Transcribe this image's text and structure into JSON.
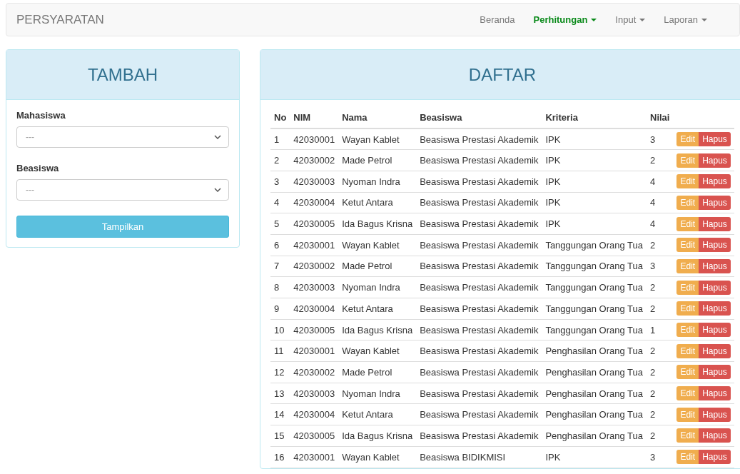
{
  "navbar": {
    "brand": "PERSYARATAN",
    "items": [
      {
        "label": "Beranda",
        "selected": false,
        "dropdown": false
      },
      {
        "label": "Perhitungan",
        "selected": true,
        "dropdown": true
      },
      {
        "label": "Input",
        "selected": false,
        "dropdown": true
      },
      {
        "label": "Laporan",
        "selected": false,
        "dropdown": true
      }
    ]
  },
  "add_panel": {
    "title": "TAMBAH",
    "fields": [
      {
        "label": "Mahasiswa",
        "value": "---"
      },
      {
        "label": "Beasiswa",
        "value": "---"
      }
    ],
    "submit": "Tampilkan"
  },
  "list_panel": {
    "title": "DAFTAR",
    "columns": [
      "No",
      "NIM",
      "Nama",
      "Beasiswa",
      "Kriteria",
      "Nilai"
    ],
    "rows": [
      {
        "cells": [
          "1",
          "42030001",
          "Wayan Kablet",
          "Beasiswa Prestasi Akademik",
          "IPK",
          "3"
        ],
        "actions": [
          "Edit",
          "Hapus"
        ]
      },
      {
        "cells": [
          "2",
          "42030002",
          "Made Petrol",
          "Beasiswa Prestasi Akademik",
          "IPK",
          "2"
        ],
        "actions": [
          "Edit",
          "Hapus"
        ]
      },
      {
        "cells": [
          "3",
          "42030003",
          "Nyoman Indra",
          "Beasiswa Prestasi Akademik",
          "IPK",
          "4"
        ],
        "actions": [
          "Edit",
          "Hapus"
        ]
      },
      {
        "cells": [
          "4",
          "42030004",
          "Ketut Antara",
          "Beasiswa Prestasi Akademik",
          "IPK",
          "4"
        ],
        "actions": [
          "Edit",
          "Hapus"
        ]
      },
      {
        "cells": [
          "5",
          "42030005",
          "Ida Bagus Krisna",
          "Beasiswa Prestasi Akademik",
          "IPK",
          "4"
        ],
        "actions": [
          "Edit",
          "Hapus"
        ]
      },
      {
        "cells": [
          "6",
          "42030001",
          "Wayan Kablet",
          "Beasiswa Prestasi Akademik",
          "Tanggungan Orang Tua",
          "2"
        ],
        "actions": [
          "Edit",
          "Hapus"
        ]
      },
      {
        "cells": [
          "7",
          "42030002",
          "Made Petrol",
          "Beasiswa Prestasi Akademik",
          "Tanggungan Orang Tua",
          "3"
        ],
        "actions": [
          "Edit",
          "Hapus"
        ]
      },
      {
        "cells": [
          "8",
          "42030003",
          "Nyoman Indra",
          "Beasiswa Prestasi Akademik",
          "Tanggungan Orang Tua",
          "2"
        ],
        "actions": [
          "Edit",
          "Hapus"
        ]
      },
      {
        "cells": [
          "9",
          "42030004",
          "Ketut Antara",
          "Beasiswa Prestasi Akademik",
          "Tanggungan Orang Tua",
          "2"
        ],
        "actions": [
          "Edit",
          "Hapus"
        ]
      },
      {
        "cells": [
          "10",
          "42030005",
          "Ida Bagus Krisna",
          "Beasiswa Prestasi Akademik",
          "Tanggungan Orang Tua",
          "1"
        ],
        "actions": [
          "Edit",
          "Hapus"
        ]
      },
      {
        "cells": [
          "11",
          "42030001",
          "Wayan Kablet",
          "Beasiswa Prestasi Akademik",
          "Penghasilan Orang Tua",
          "2"
        ],
        "actions": [
          "Edit",
          "Hapus"
        ]
      },
      {
        "cells": [
          "12",
          "42030002",
          "Made Petrol",
          "Beasiswa Prestasi Akademik",
          "Penghasilan Orang Tua",
          "2"
        ],
        "actions": [
          "Edit",
          "Hapus"
        ]
      },
      {
        "cells": [
          "13",
          "42030003",
          "Nyoman Indra",
          "Beasiswa Prestasi Akademik",
          "Penghasilan Orang Tua",
          "2"
        ],
        "actions": [
          "Edit",
          "Hapus"
        ]
      },
      {
        "cells": [
          "14",
          "42030004",
          "Ketut Antara",
          "Beasiswa Prestasi Akademik",
          "Penghasilan Orang Tua",
          "2"
        ],
        "actions": [
          "Edit",
          "Hapus"
        ]
      },
      {
        "cells": [
          "15",
          "42030005",
          "Ida Bagus Krisna",
          "Beasiswa Prestasi Akademik",
          "Penghasilan Orang Tua",
          "2"
        ],
        "actions": [
          "Edit",
          "Hapus"
        ]
      },
      {
        "cells": [
          "16",
          "42030001",
          "Wayan Kablet",
          "Beasiswa BIDIKMISI",
          "IPK",
          "3"
        ],
        "actions": [
          "Edit",
          "Hapus"
        ]
      }
    ]
  }
}
